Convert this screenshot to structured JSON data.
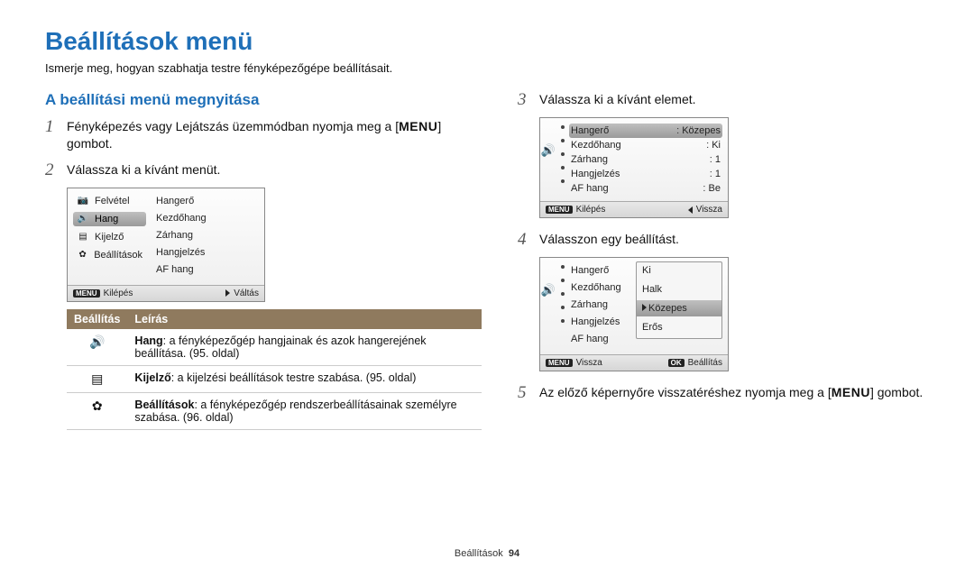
{
  "page": {
    "title": "Beállítások menü",
    "subtitle": "Ismerje meg, hogyan szabhatja testre fényképezőgépe beállításait."
  },
  "left": {
    "section_title": "A beállítási menü megnyitása",
    "step1_num": "1",
    "step1_text_a": "Fényképezés vagy Lejátszás üzemmódban nyomja meg a [",
    "step1_menu": "MENU",
    "step1_text_b": "] gombot.",
    "step2_num": "2",
    "step2_text": "Válassza ki a kívánt menüt.",
    "screen1": {
      "left": [
        {
          "label": "Felvétel",
          "icon": "camera"
        },
        {
          "label": "Hang",
          "icon": "speaker",
          "selected": true
        },
        {
          "label": "Kijelző",
          "icon": "display"
        },
        {
          "label": "Beállítások",
          "icon": "gear"
        }
      ],
      "right": [
        "Hangerő",
        "Kezdőhang",
        "Zárhang",
        "Hangjelzés",
        "AF hang"
      ],
      "foot_left_chip": "MENU",
      "foot_left": "Kilépés",
      "foot_right": "Váltás"
    },
    "table": {
      "head_a": "Beállítás",
      "head_b": "Leírás",
      "rows": [
        {
          "icon": "speaker",
          "bold": "Hang",
          "text": ": a fényképezőgép hangjainak és azok hangerejének beállítása. (95. oldal)"
        },
        {
          "icon": "display",
          "bold": "Kijelző",
          "text": ": a kijelzési beállítások testre szabása. (95. oldal)"
        },
        {
          "icon": "gear",
          "bold": "Beállítások",
          "text": ": a fényképezőgép rendszerbeállításainak személyre szabása. (96. oldal)"
        }
      ]
    }
  },
  "right": {
    "step3_num": "3",
    "step3_text": "Válassza ki a kívánt elemet.",
    "screen2": {
      "rows": [
        {
          "label": "Hangerő",
          "val": "Közepes",
          "selected": true
        },
        {
          "label": "Kezdőhang",
          "val": "Ki"
        },
        {
          "label": "Zárhang",
          "val": "1"
        },
        {
          "label": "Hangjelzés",
          "val": "1"
        },
        {
          "label": "AF hang",
          "val": "Be"
        }
      ],
      "foot_left_chip": "MENU",
      "foot_left": "Kilépés",
      "foot_right": "Vissza"
    },
    "step4_num": "4",
    "step4_text": "Válasszon egy beállítást.",
    "screen3": {
      "left": [
        "Hangerő",
        "Kezdőhang",
        "Zárhang",
        "Hangjelzés",
        "AF hang"
      ],
      "opts": [
        {
          "label": "Ki"
        },
        {
          "label": "Halk"
        },
        {
          "label": "Közepes",
          "selected": true
        },
        {
          "label": "Erős"
        }
      ],
      "foot_left_chip": "MENU",
      "foot_left": "Vissza",
      "foot_right_chip": "OK",
      "foot_right": "Beállítás"
    },
    "step5_num": "5",
    "step5_text_a": "Az előző képernyőre visszatéréshez nyomja meg a [",
    "step5_menu": "MENU",
    "step5_text_b": "] gombot."
  },
  "footer": {
    "label": "Beállítások",
    "page": "94"
  },
  "icons": {
    "camera": "📷",
    "speaker": "🔊",
    "display": "▤",
    "gear": "✿"
  }
}
